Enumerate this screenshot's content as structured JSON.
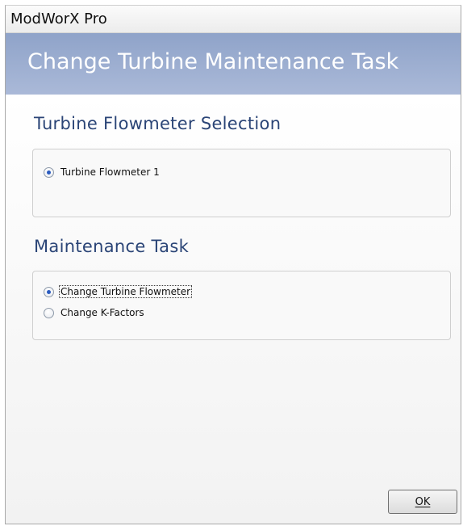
{
  "window": {
    "title": "ModWorX Pro"
  },
  "banner": {
    "heading": "Change Turbine Maintenance Task"
  },
  "flowmeter_selection": {
    "title": "Turbine Flowmeter Selection",
    "options": [
      {
        "label": "Turbine Flowmeter 1",
        "selected": true
      }
    ]
  },
  "maintenance_task": {
    "title": "Maintenance Task",
    "options": [
      {
        "label": "Change Turbine Flowmeter",
        "selected": true
      },
      {
        "label": "Change K-Factors",
        "selected": false
      }
    ]
  },
  "buttons": {
    "ok_label": "OK"
  },
  "colors": {
    "banner": "#9aaed0",
    "section_title": "#2a4476",
    "radio_dot": "#2a5bbf"
  }
}
